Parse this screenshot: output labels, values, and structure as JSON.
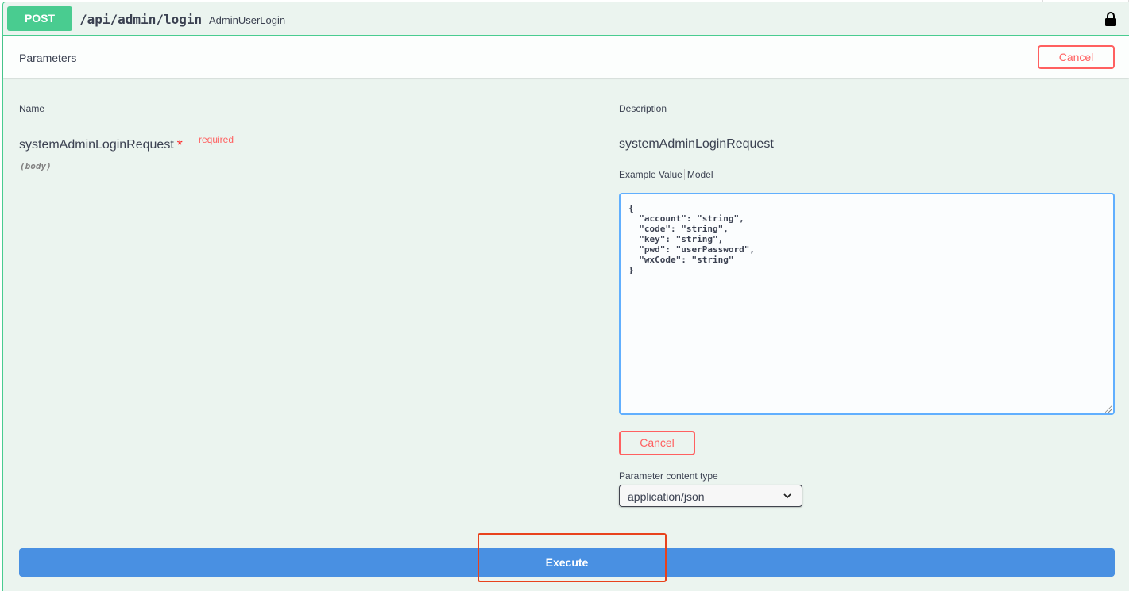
{
  "operation": {
    "method": "POST",
    "path": "/api/admin/login",
    "summary": "AdminUserLogin",
    "lock_icon": "lock-icon"
  },
  "parameters": {
    "title": "Parameters",
    "cancel_label": "Cancel",
    "col_name": "Name",
    "col_description": "Description",
    "param": {
      "name": "systemAdminLoginRequest",
      "star": "*",
      "required": "required",
      "in": "(body)",
      "description": "systemAdminLoginRequest",
      "tab_example": "Example Value",
      "tab_model": "Model",
      "body_value": "{\n  \"account\": \"string\",\n  \"code\": \"string\",\n  \"key\": \"string\",\n  \"pwd\": \"userPassword\",\n  \"wxCode\": \"string\"\n}",
      "cancel_label": "Cancel",
      "content_type_label": "Parameter content type",
      "content_type_value": "application/json"
    }
  },
  "execute": {
    "label": "Execute"
  },
  "colors": {
    "method_post": "#49cc90",
    "execute": "#4990e2",
    "cancel": "#ff6060",
    "highlight": "#e8421c"
  }
}
